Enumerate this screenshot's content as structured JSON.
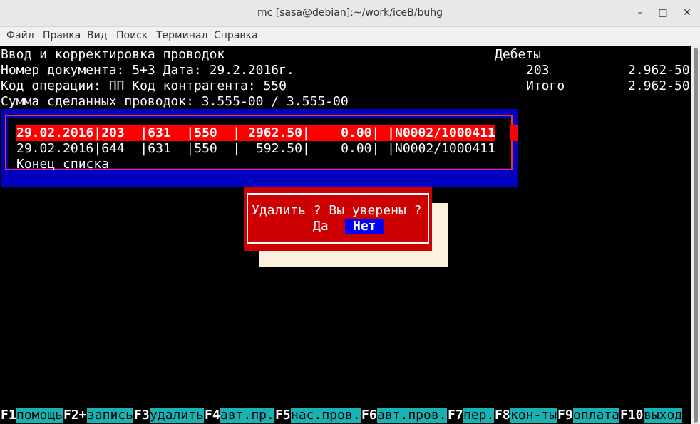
{
  "window": {
    "title": "mc [sasa@debian]:~/work/iceB/buhg",
    "minimize_glyph": "–",
    "maximize_glyph": "□",
    "close_glyph": "✕"
  },
  "menu": [
    "Файл",
    "Правка",
    "Вид",
    "Поиск",
    "Терминал",
    "Справка"
  ],
  "header": {
    "line1": "Ввод и корректировка проводок",
    "line2": "Номер документа: 5+3 Дата: 29.2.2016г.",
    "line3": "Код операции: ПП Код контрагента: 550",
    "line4": "Сумма сделанных проводок: 3.555-00 / 3.555-00"
  },
  "debits": {
    "title": "Дебеты",
    "account": "203",
    "account_value": "2.962-50",
    "total_label": "Итого",
    "total_value": "2.962-50"
  },
  "entries": [
    "29.02.2016|203  |631  |550  | 2962.50|    0.00| |N0002/1000411",
    "29.02.2016|644  |631  |550  |  592.50|    0.00| |N0002/1000411"
  ],
  "list_end": "Конец списка",
  "dialog": {
    "message": "Удалить ? Вы уверены ?",
    "yes": "Да",
    "no": "Нет"
  },
  "fkeys": [
    {
      "key": "F1",
      "label": "помощь"
    },
    {
      "key": "F2+",
      "label": "запись"
    },
    {
      "key": "F3",
      "label": "удалить"
    },
    {
      "key": "F4",
      "label": "авт.пр."
    },
    {
      "key": "F5",
      "label": "нас.пров."
    },
    {
      "key": "F6",
      "label": "авт.пров."
    },
    {
      "key": "F7",
      "label": "пер."
    },
    {
      "key": "F8",
      "label": "кон-ты"
    },
    {
      "key": "F9",
      "label": "оплата"
    },
    {
      "key": "F10",
      "label": "выход"
    }
  ]
}
